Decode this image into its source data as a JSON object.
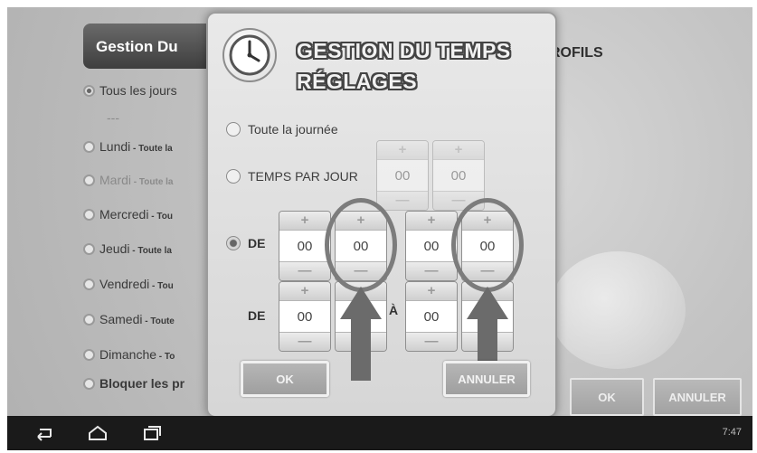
{
  "background": {
    "header_title": "Gestion Du",
    "profils_label": "ROFILS",
    "all_days": "Tous les jours",
    "separator": "---",
    "days": [
      {
        "name": "Lundi",
        "suffix": " - Toute la"
      },
      {
        "name": "Mardi",
        "suffix": " - Toute la"
      },
      {
        "name": "Mercredi",
        "suffix": " - Tou"
      },
      {
        "name": "Jeudi",
        "suffix": " - Toute la"
      },
      {
        "name": "Vendredi",
        "suffix": " - Tou"
      },
      {
        "name": "Samedi",
        "suffix": " - Toute"
      },
      {
        "name": "Dimanche",
        "suffix": " - To"
      }
    ],
    "block_label": "Bloquer les pr",
    "ok_label": "OK",
    "cancel_label": "ANNULER"
  },
  "dialog": {
    "title_line1": "GESTION DU TEMPS",
    "title_line2": "RÉGLAGES",
    "option_all_day": "Toute la journée",
    "option_time_per_day": "TEMPS PAR JOUR",
    "de_label": "DE",
    "a_label": "À",
    "plus": "+",
    "minus": "—",
    "spinner_value": "00",
    "ok_label": "OK",
    "cancel_label": "ANNULER"
  },
  "navbar": {
    "back_icon": "back-icon",
    "home_icon": "home-icon",
    "recent_icon": "recent-apps-icon",
    "time": "7:47"
  },
  "colors": {
    "dialog_bg": "#e2e2e2",
    "header_dark": "#4e4e4e",
    "navbar": "#1a1a1a",
    "highlight": "#7c7c7c"
  }
}
